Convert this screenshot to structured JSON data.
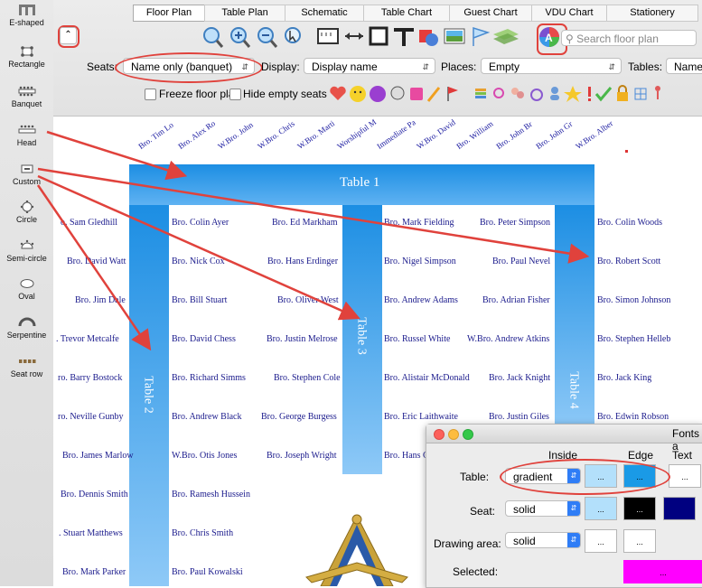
{
  "colors": {
    "annotation": "#e0423c",
    "table_fill": "#1c8ee3",
    "name_text": "#1a1a8c",
    "magenta": "#ff00ff"
  },
  "toolbar_left": {
    "items": [
      {
        "label": "E-shaped",
        "icon": "e-shaped-table-icon"
      },
      {
        "label": "Rectangle",
        "icon": "rectangle-table-icon"
      },
      {
        "label": "Banquet",
        "icon": "banquet-table-icon"
      },
      {
        "label": "Head",
        "icon": "head-table-icon"
      },
      {
        "label": "Custom",
        "icon": "custom-table-icon"
      },
      {
        "label": "Circle",
        "icon": "circle-table-icon"
      },
      {
        "label": "Semi-circle",
        "icon": "semi-circle-table-icon"
      },
      {
        "label": "Oval",
        "icon": "oval-table-icon"
      },
      {
        "label": "Serpentine",
        "icon": "serpentine-table-icon"
      },
      {
        "label": "Seat row",
        "icon": "seat-row-icon"
      }
    ]
  },
  "tabs": [
    {
      "label": "Floor Plan",
      "active": true
    },
    {
      "label": "Table Plan"
    },
    {
      "label": "Schematic"
    },
    {
      "label": "Table Chart"
    },
    {
      "label": "Guest Chart"
    },
    {
      "label": "VDU Chart"
    },
    {
      "label": "Stationery"
    }
  ],
  "search": {
    "placeholder": "Search floor plan"
  },
  "options": {
    "seats_label": "Seats:",
    "seats_value": "Name only (banquet)",
    "display_label": "Display:",
    "display_value": "Display name",
    "places_label": "Places:",
    "places_value": "Empty",
    "tables_label": "Tables:",
    "tables_value": "Name"
  },
  "checks": {
    "freeze": "Freeze floor plan",
    "hide": "Hide empty seats"
  },
  "rotated_names": [
    "Bro. Tim Lo",
    "Bro. Alex Ro",
    "W.Bro. John",
    "W.Bro. Chris",
    "W.Bro. Marti",
    "Worshipful M",
    "Immediate Pa",
    "W.Bro. David",
    "Bro. William",
    "Bro. John Br",
    "Bro. John Gr",
    "W.Bro. Alber"
  ],
  "tables": {
    "t1": "Table 1",
    "t2": "Table 2",
    "t3": "Table 3",
    "t4": "Table 4"
  },
  "seats": {
    "col_a": [
      "o. Sam Gledhill",
      "Bro. David Watt",
      "Bro. Jim Dale",
      ". Trevor Metcalfe",
      "ro. Barry Bostock",
      "ro. Neville Gunby",
      "Bro. James Marlow",
      "Bro. Dennis Smith",
      ". Stuart Matthews",
      "Bro. Mark Parker"
    ],
    "col_b": [
      "Bro. Colin Ayer",
      "Bro. Nick Cox",
      "Bro. Bill Stuart",
      "Bro. David Chess",
      "Bro. Richard Simms",
      "Bro. Andrew Black",
      "W.Bro. Otis Jones",
      "Bro. Ramesh Hussein",
      "Bro. Chris Smith",
      "Bro. Paul Kowalski"
    ],
    "col_c": [
      "Bro. Ed Markham",
      "Bro. Hans Erdinger",
      "Bro. Oliver West",
      "Bro. Justin Melrose",
      "Bro. Stephen Cole",
      "Bro. George Burgess",
      "Bro. Joseph Wright"
    ],
    "col_d": [
      "Bro. Mark Fielding",
      "Bro. Nigel Simpson",
      "Bro. Andrew Adams",
      "Bro. Russel White",
      "Bro. Alistair McDonald",
      "Bro. Eric Laithwaite",
      "Bro. Hans C"
    ],
    "col_e": [
      "Bro. Peter Simpson",
      "Bro. Paul Nevel",
      "Bro. Adrian Fisher",
      "W.Bro. Andrew Atkins",
      "Bro. Jack Knight",
      "Bro. Justin Giles"
    ],
    "col_f": [
      "Bro. Colin Woods",
      "Bro. Robert Scott",
      "Bro. Simon Johnson",
      "Bro. Stephen Helleb",
      "Bro. Jack King",
      "Bro. Edwin Robson"
    ]
  },
  "fonts_panel": {
    "title": "Fonts a",
    "headers": {
      "inside": "Inside",
      "edge": "Edge",
      "text": "Text"
    },
    "rows": [
      {
        "label": "Table:",
        "style": "gradient"
      },
      {
        "label": "Seat:",
        "style": "solid"
      },
      {
        "label": "Drawing area:",
        "style": "solid"
      },
      {
        "label": "Selected:"
      }
    ],
    "ellipsis": "..."
  }
}
